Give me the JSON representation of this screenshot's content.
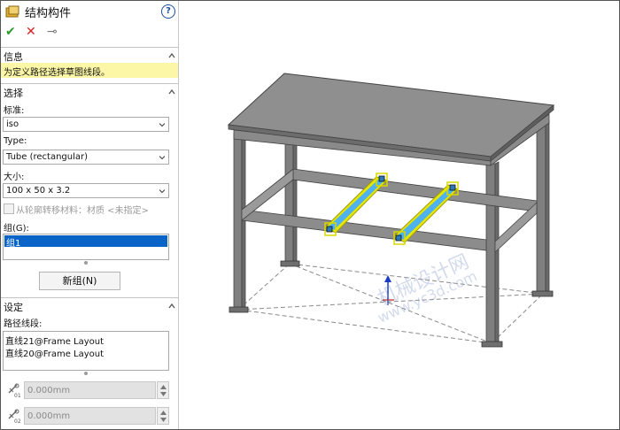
{
  "panel": {
    "title": "结构构件",
    "help": "?",
    "toolbar": {
      "ok": "✔",
      "cancel": "✕",
      "pin": "⊸"
    },
    "info": {
      "heading": "信息",
      "message": "为定义路径选择草图线段。"
    },
    "selection": {
      "heading": "选择",
      "standard_label": "标准:",
      "standard_value": "iso",
      "type_label": "Type:",
      "type_value": "Tube (rectangular)",
      "size_label": "大小:",
      "size_value": "100 x 50 x 3.2",
      "transfer_material": "从轮廓转移材料：材质 <未指定>",
      "groups_label": "组(G):",
      "groups": [
        "组1"
      ],
      "new_group_button": "新组(N)"
    },
    "settings": {
      "heading": "设定",
      "path_segments_label": "路径线段:",
      "path_segments": [
        "直线21@Frame Layout",
        "直线20@Frame Layout"
      ],
      "offset1_value": "0.000mm",
      "offset2_value": "0.000mm",
      "offset1_subscript": "01",
      "offset2_subscript": "02"
    }
  },
  "viewport": {
    "watermark_line1": "机械设计网",
    "watermark_line2": "www.yc3d.com"
  },
  "colors": {
    "info_highlight": "#fbf7a6",
    "selection_highlight": "#0a64c8",
    "frame_gray": "#7f7f7f",
    "beam_highlight": "#e6e600",
    "beam_blue": "#4fb2ef",
    "ok_green": "#2e9a2e",
    "cancel_red": "#d42020"
  }
}
